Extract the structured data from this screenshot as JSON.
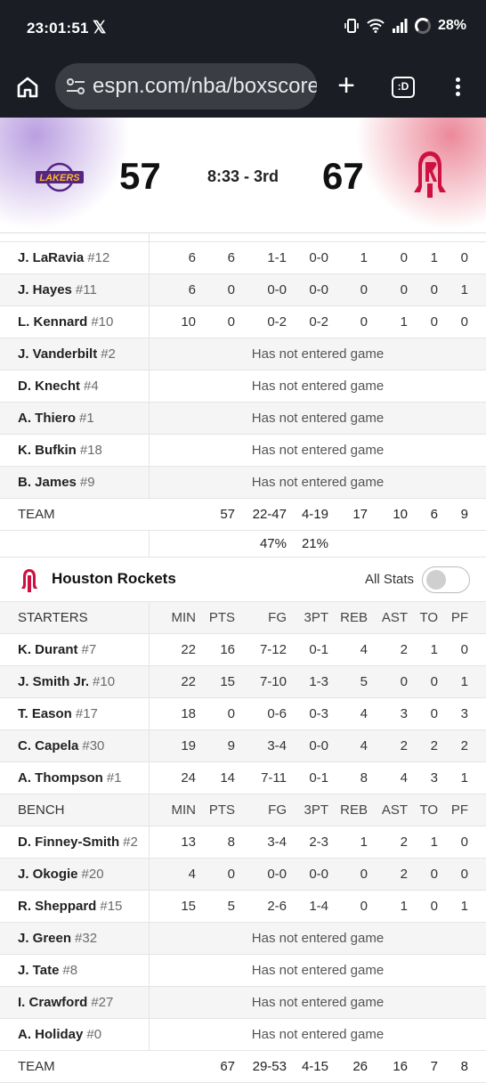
{
  "status_bar": {
    "time": "23:01:51",
    "battery": "28%"
  },
  "browser": {
    "url": "espn.com/nba/boxscore",
    "tabs_label": ":D"
  },
  "scoreboard": {
    "away_score": "57",
    "clock": "8:33 - 3rd",
    "home_score": "67"
  },
  "columns": [
    "MIN",
    "PTS",
    "FG",
    "3PT",
    "REB",
    "AST",
    "TO",
    "PF"
  ],
  "lakers_rows": [
    {
      "name": "J. LaRavia",
      "num": "#12",
      "stats": [
        "6",
        "6",
        "1-1",
        "0-0",
        "1",
        "0",
        "1",
        "0"
      ]
    },
    {
      "name": "J. Hayes",
      "num": "#11",
      "stats": [
        "6",
        "0",
        "0-0",
        "0-0",
        "0",
        "0",
        "0",
        "1"
      ]
    },
    {
      "name": "L. Kennard",
      "num": "#10",
      "stats": [
        "10",
        "0",
        "0-2",
        "0-2",
        "0",
        "1",
        "0",
        "0"
      ]
    },
    {
      "name": "J. Vanderbilt",
      "num": "#2",
      "dnp": "Has not entered game"
    },
    {
      "name": "D. Knecht",
      "num": "#4",
      "dnp": "Has not entered game"
    },
    {
      "name": "A. Thiero",
      "num": "#1",
      "dnp": "Has not entered game"
    },
    {
      "name": "K. Bufkin",
      "num": "#18",
      "dnp": "Has not entered game"
    },
    {
      "name": "B. James",
      "num": "#9",
      "dnp": "Has not entered game"
    }
  ],
  "lakers_team": {
    "label": "TEAM",
    "stats": [
      "",
      "57",
      "22-47",
      "4-19",
      "17",
      "10",
      "6",
      "9"
    ]
  },
  "lakers_pct": {
    "fg": "47%",
    "three": "21%"
  },
  "rockets": {
    "team_name": "Houston Rockets",
    "all_stats_label": "All Stats",
    "starters_label": "STARTERS",
    "bench_label": "BENCH",
    "starters": [
      {
        "name": "K. Durant",
        "num": "#7",
        "stats": [
          "22",
          "16",
          "7-12",
          "0-1",
          "4",
          "2",
          "1",
          "0"
        ]
      },
      {
        "name": "J. Smith Jr.",
        "num": "#10",
        "stats": [
          "22",
          "15",
          "7-10",
          "1-3",
          "5",
          "0",
          "0",
          "1"
        ]
      },
      {
        "name": "T. Eason",
        "num": "#17",
        "stats": [
          "18",
          "0",
          "0-6",
          "0-3",
          "4",
          "3",
          "0",
          "3"
        ]
      },
      {
        "name": "C. Capela",
        "num": "#30",
        "stats": [
          "19",
          "9",
          "3-4",
          "0-0",
          "4",
          "2",
          "2",
          "2"
        ]
      },
      {
        "name": "A. Thompson",
        "num": "#1",
        "stats": [
          "24",
          "14",
          "7-11",
          "0-1",
          "8",
          "4",
          "3",
          "1"
        ]
      }
    ],
    "bench": [
      {
        "name": "D. Finney-Smith",
        "num": "#2",
        "stats": [
          "13",
          "8",
          "3-4",
          "2-3",
          "1",
          "2",
          "1",
          "0"
        ]
      },
      {
        "name": "J. Okogie",
        "num": "#20",
        "stats": [
          "4",
          "0",
          "0-0",
          "0-0",
          "0",
          "2",
          "0",
          "0"
        ]
      },
      {
        "name": "R. Sheppard",
        "num": "#15",
        "stats": [
          "15",
          "5",
          "2-6",
          "1-4",
          "0",
          "1",
          "0",
          "1"
        ]
      },
      {
        "name": "J. Green",
        "num": "#32",
        "dnp": "Has not entered game"
      },
      {
        "name": "J. Tate",
        "num": "#8",
        "dnp": "Has not entered game"
      },
      {
        "name": "I. Crawford",
        "num": "#27",
        "dnp": "Has not entered game"
      },
      {
        "name": "A. Holiday",
        "num": "#0",
        "dnp": "Has not entered game"
      }
    ],
    "team": {
      "label": "TEAM",
      "stats": [
        "",
        "67",
        "29-53",
        "4-15",
        "26",
        "16",
        "7",
        "8"
      ]
    }
  }
}
